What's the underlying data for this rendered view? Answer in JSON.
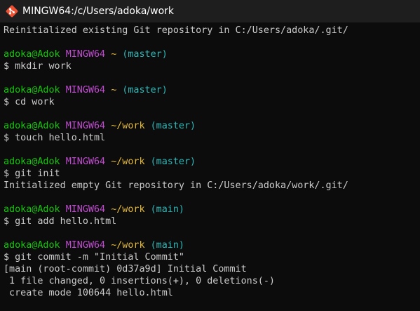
{
  "window": {
    "title": "MINGW64:/c/Users/adoka/work",
    "icon": "git-bash-icon"
  },
  "colors": {
    "user": "#16c60c",
    "host": "#c14bd1",
    "path": "#e4b93a",
    "branch": "#2fb7b7",
    "text": "#cccccc",
    "background": "#0c0c0c"
  },
  "terminal": {
    "lines": [
      {
        "kind": "output",
        "text": "Reinitialized existing Git repository in C:/Users/adoka/.git/"
      },
      {
        "kind": "blank"
      },
      {
        "kind": "prompt",
        "user": "adoka@Adok",
        "host": "MINGW64",
        "path": "~",
        "branch": "(master)"
      },
      {
        "kind": "command",
        "text": "$ mkdir work"
      },
      {
        "kind": "blank"
      },
      {
        "kind": "prompt",
        "user": "adoka@Adok",
        "host": "MINGW64",
        "path": "~",
        "branch": "(master)"
      },
      {
        "kind": "command",
        "text": "$ cd work"
      },
      {
        "kind": "blank"
      },
      {
        "kind": "prompt",
        "user": "adoka@Adok",
        "host": "MINGW64",
        "path": "~/work",
        "branch": "(master)"
      },
      {
        "kind": "command",
        "text": "$ touch hello.html"
      },
      {
        "kind": "blank"
      },
      {
        "kind": "prompt",
        "user": "adoka@Adok",
        "host": "MINGW64",
        "path": "~/work",
        "branch": "(master)"
      },
      {
        "kind": "command",
        "text": "$ git init"
      },
      {
        "kind": "output",
        "text": "Initialized empty Git repository in C:/Users/adoka/work/.git/"
      },
      {
        "kind": "blank"
      },
      {
        "kind": "prompt",
        "user": "adoka@Adok",
        "host": "MINGW64",
        "path": "~/work",
        "branch": "(main)"
      },
      {
        "kind": "command",
        "text": "$ git add hello.html"
      },
      {
        "kind": "blank"
      },
      {
        "kind": "prompt",
        "user": "adoka@Adok",
        "host": "MINGW64",
        "path": "~/work",
        "branch": "(main)"
      },
      {
        "kind": "command",
        "text": "$ git commit -m \"Initial Commit\""
      },
      {
        "kind": "output",
        "text": "[main (root-commit) 0d37a9d] Initial Commit"
      },
      {
        "kind": "output",
        "text": " 1 file changed, 0 insertions(+), 0 deletions(-)"
      },
      {
        "kind": "output",
        "text": " create mode 100644 hello.html"
      }
    ]
  }
}
